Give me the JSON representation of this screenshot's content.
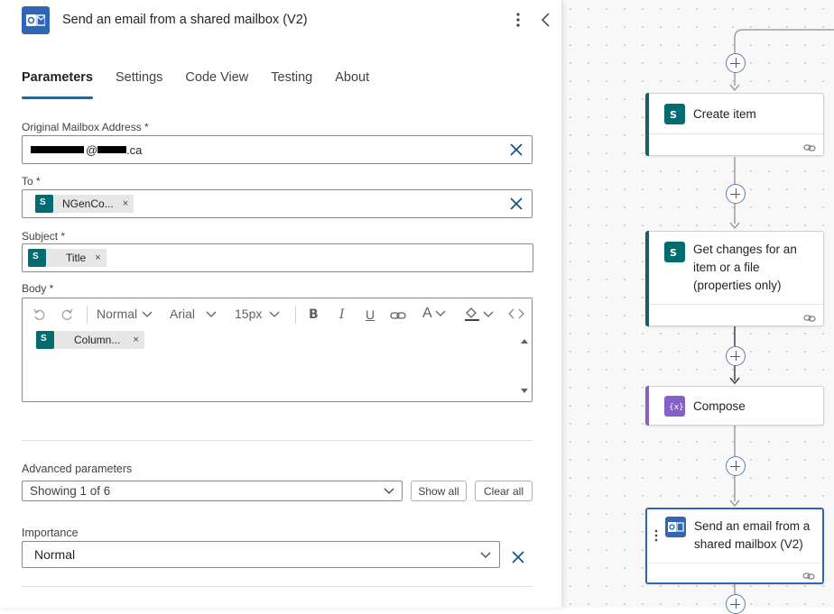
{
  "panel": {
    "title": "Send an email from a shared mailbox (V2)",
    "icon": "outlook-icon",
    "tabs": [
      {
        "label": "Parameters",
        "active": true
      },
      {
        "label": "Settings",
        "active": false
      },
      {
        "label": "Code View",
        "active": false
      },
      {
        "label": "Testing",
        "active": false
      },
      {
        "label": "About",
        "active": false
      }
    ],
    "fields": {
      "mailbox_label": "Original Mailbox Address *",
      "mailbox_at": "@",
      "mailbox_suffix": ".ca",
      "to_label": "To *",
      "to_token": "NGenCo...",
      "subject_label": "Subject *",
      "subject_token": "Title",
      "body_label": "Body *",
      "body_token": "Column...",
      "token_remove": "×"
    },
    "toolbar": {
      "style": "Normal",
      "font": "Arial",
      "size": "15px",
      "bold": "B",
      "italic": "I",
      "underline": "U",
      "font_color": "A"
    },
    "advanced": {
      "label": "Advanced parameters",
      "value": "Showing 1 of 6",
      "show_all": "Show all",
      "clear_all": "Clear all"
    },
    "importance": {
      "label": "Importance",
      "value": "Normal"
    }
  },
  "canvas": {
    "cards": [
      {
        "title_lines": [
          "Create item"
        ],
        "icon": "sharepoint-icon",
        "accent": "#1b5e5a"
      },
      {
        "title_lines": [
          "Get changes for an",
          "item or a file",
          "(properties only)"
        ],
        "icon": "sharepoint-icon",
        "accent": "#1b5e5a"
      },
      {
        "title_lines": [
          "Compose"
        ],
        "icon": "compose-icon",
        "accent": "#8661c5"
      },
      {
        "title_lines": [
          "Send an email from a",
          "shared mailbox (V2)"
        ],
        "icon": "outlook-icon",
        "accent": "#2f67b5",
        "selected": true
      }
    ]
  },
  "colors": {
    "accent": "#0f6cbd",
    "sharepoint": "#036c70",
    "outlook": "#2f67b5",
    "compose": "#8661c5"
  }
}
